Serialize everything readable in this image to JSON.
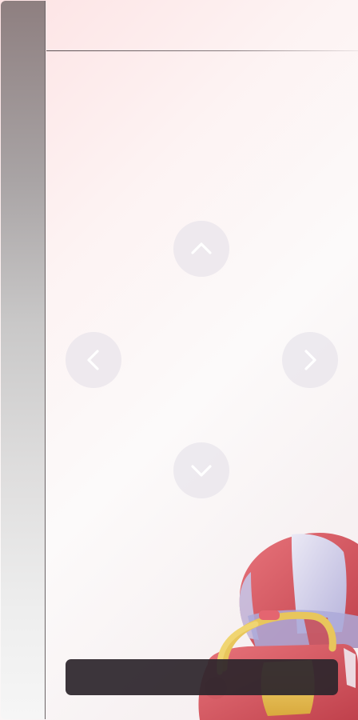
{
  "navigation": {
    "up": {
      "icon": "chevron-up-icon"
    },
    "down": {
      "icon": "chevron-down-icon"
    },
    "left": {
      "icon": "chevron-left-icon"
    },
    "right": {
      "icon": "chevron-right-icon"
    }
  },
  "decoration": {
    "illustration": "hot-air-balloon-with-bag"
  },
  "colors": {
    "background_top": "#fde3e4",
    "background_bottom": "#f6eef0",
    "nav_button": "#e1dee8",
    "nav_icon": "#ffffff",
    "bottom_bar": "#2d262c",
    "balloon_red": "#d6545e",
    "balloon_lavender": "#c9c6e6",
    "bag_yellow": "#e9c558"
  }
}
